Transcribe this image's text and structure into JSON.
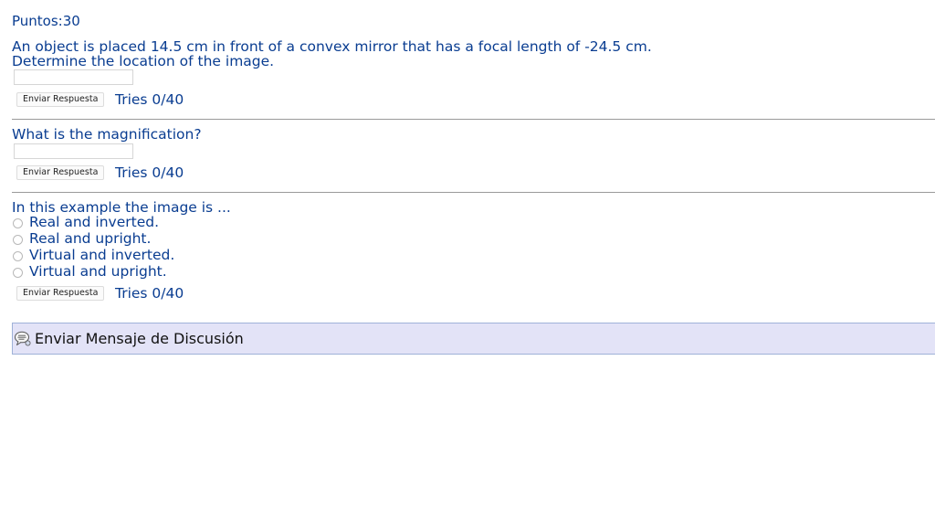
{
  "header": {
    "points": "Puntos:30"
  },
  "questions": [
    {
      "line1": "An object is placed 14.5 cm in front of a convex mirror that has a focal length of -24.5 cm.",
      "line2": "Determine the location of the image.",
      "input_value": "",
      "submit_label": "Enviar Respuesta",
      "tries": "Tries 0/40"
    },
    {
      "line1": "What is the magnification?",
      "input_value": "",
      "submit_label": "Enviar Respuesta",
      "tries": "Tries 0/40"
    },
    {
      "line1": "In this example the image is ...",
      "options": [
        "Real and inverted.",
        "Real and upright.",
        "Virtual and inverted.",
        "Virtual and upright."
      ],
      "selected": null,
      "submit_label": "Enviar Respuesta",
      "tries": "Tries 0/40"
    }
  ],
  "discussion": {
    "icon": "speech-bubble-icon",
    "label": "Enviar Mensaje de Discusión"
  }
}
